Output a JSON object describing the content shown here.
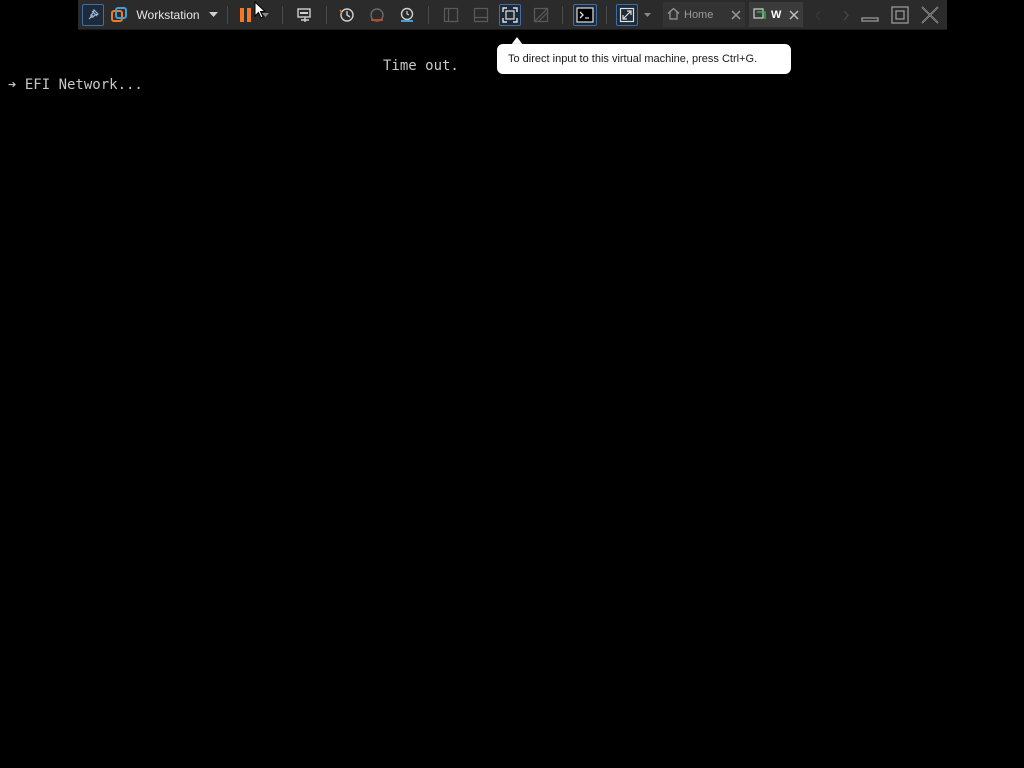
{
  "toolbar": {
    "product_label": "Workstation",
    "icons": [
      "pin-icon",
      "vmware-logo-icon",
      "dropdown-arrow-icon",
      "pause-icon",
      "pause-dropdown-icon",
      "send-keys-icon",
      "snapshot-icon",
      "revert-snapshot-icon",
      "snapshot-manager-icon",
      "library-view-icon",
      "thumbnail-view-icon",
      "fullscreen-icon",
      "unity-icon",
      "console-view-icon",
      "stretch-guest-icon",
      "stretch-dropdown-icon",
      "minimize-icon",
      "restore-icon",
      "close-icon"
    ]
  },
  "tabs": [
    {
      "label": "Home",
      "icon": "home-icon",
      "active": false
    },
    {
      "label": "W",
      "icon": "vm-icon",
      "active": true
    }
  ],
  "tooltip": {
    "text": "To direct input to this virtual machine, press Ctrl+G."
  },
  "console": {
    "timeout_text": "Time out.",
    "boot_line": "➔ EFI Network..."
  },
  "colors": {
    "toolbar_bg": "#2b2b2b",
    "pause_orange": "#f07a22",
    "accent_blue": "#3d6fa8",
    "console_text": "#c8c8c8",
    "screen_bg": "#000000"
  }
}
